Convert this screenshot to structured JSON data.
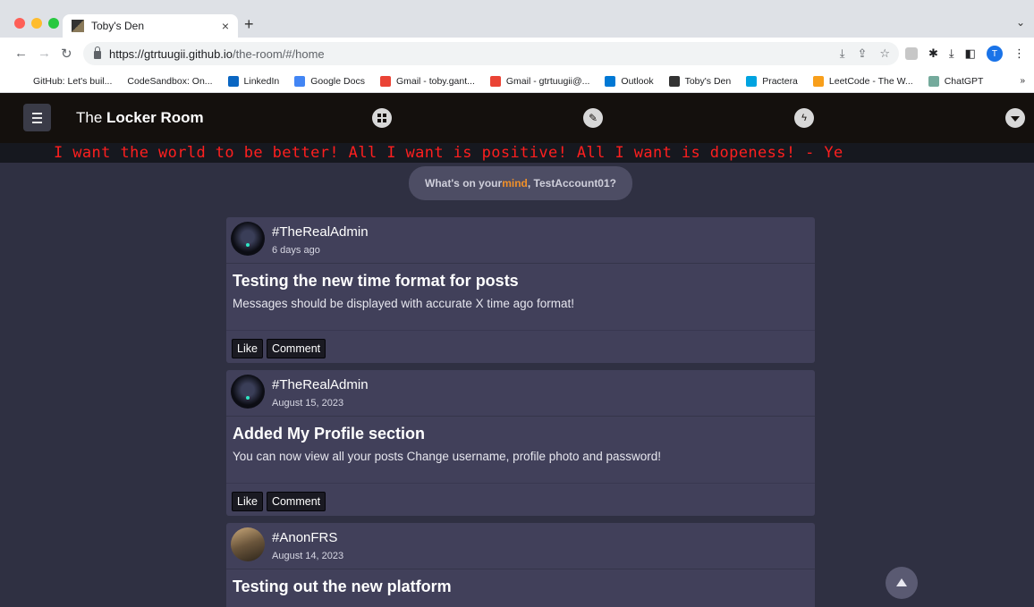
{
  "browser": {
    "tab_title": "Toby's Den",
    "tab_close": "×",
    "new_tab": "+",
    "tab_menu": "⌄",
    "url_host": "https://gtrtuugii.github.io",
    "url_path": "/the-room/#/home",
    "profile_initial": "T",
    "bookmarks": [
      {
        "label": "GitHub: Let's buil...",
        "icon_color": "#ffffff",
        "icon_name": "github-icon"
      },
      {
        "label": "CodeSandbox: On...",
        "icon_color": "#ffffff",
        "icon_name": "codesandbox-icon"
      },
      {
        "label": "LinkedIn",
        "icon_color": "#0a66c2",
        "icon_name": "linkedin-icon"
      },
      {
        "label": "Google Docs",
        "icon_color": "#4285f4",
        "icon_name": "google-docs-icon"
      },
      {
        "label": "Gmail - toby.gant...",
        "icon_color": "#ea4335",
        "icon_name": "gmail-icon"
      },
      {
        "label": "Gmail - gtrtuugii@...",
        "icon_color": "#ea4335",
        "icon_name": "gmail-icon"
      },
      {
        "label": "Outlook",
        "icon_color": "#0078d4",
        "icon_name": "outlook-icon"
      },
      {
        "label": "Toby's Den",
        "icon_color": "#333333",
        "icon_name": "tobys-den-icon"
      },
      {
        "label": "Practera",
        "icon_color": "#00a3e0",
        "icon_name": "practera-icon"
      },
      {
        "label": "LeetCode - The W...",
        "icon_color": "#f89f1b",
        "icon_name": "leetcode-icon"
      },
      {
        "label": "ChatGPT",
        "icon_color": "#74aa9c",
        "icon_name": "chatgpt-icon"
      }
    ],
    "bookmarks_more": "»"
  },
  "app": {
    "brand_prefix": "The ",
    "brand_bold": "Locker Room",
    "marquee": "I want the world to be better! All I want is positive! All I want is dopeness! - Ye",
    "composer": {
      "prefix": "What's on your ",
      "highlight": "mind",
      "suffix": ", TestAccount01?"
    },
    "like_label": "Like",
    "comment_label": "Comment"
  },
  "posts": [
    {
      "username": "#TheRealAdmin",
      "time": "6 days ago",
      "title": "Testing the new time format for posts",
      "body": "Messages should be displayed with accurate X time ago format!"
    },
    {
      "username": "#TheRealAdmin",
      "time": "August 15, 2023",
      "title": "Added My Profile section",
      "body": "You can now view all your posts Change username, profile photo and password!"
    },
    {
      "username": "#AnonFRS",
      "time": "August 14, 2023",
      "title": "Testing out the new platform",
      "body": ""
    }
  ]
}
